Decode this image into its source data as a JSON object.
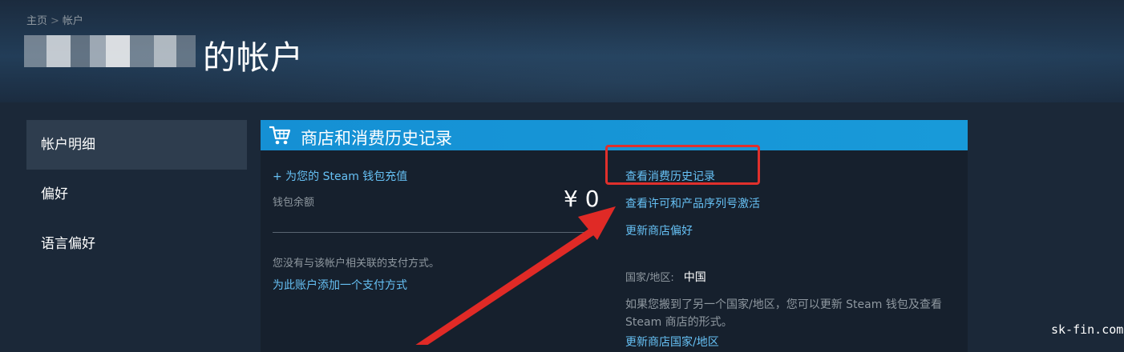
{
  "breadcrumb": {
    "home": "主页",
    "separator": ">",
    "current": "帐户"
  },
  "page_title": "的帐户",
  "sidebar": {
    "items": [
      {
        "label": "帐户明细",
        "active": true
      },
      {
        "label": "偏好",
        "active": false
      },
      {
        "label": "语言偏好",
        "active": false
      }
    ]
  },
  "panel": {
    "title": "商店和消费历史记录",
    "icon": "cart-icon",
    "left": {
      "add_funds": "+ 为您的 Steam 钱包充值",
      "wallet_label": "钱包余额",
      "wallet_amount": "¥ 0",
      "no_payment_text": "您没有与该帐户相关联的支付方式。",
      "add_payment_link": "为此账户添加一个支付方式"
    },
    "right": {
      "link_history": "查看消费历史记录",
      "link_licenses": "查看许可和产品序列号激活",
      "link_store_prefs": "更新商店偏好",
      "country_label": "国家/地区:",
      "country_value": "中国",
      "country_note": "如果您搬到了另一个国家/地区，您可以更新 Steam 钱包及查看 Steam 商店的形式。",
      "link_update_country": "更新商店国家/地区"
    }
  },
  "colors": {
    "background": "#1b2838",
    "header_bar": "#1a9fff",
    "link": "#66c0f4",
    "annotation": "#e0302c"
  },
  "watermark": "sk-fin.com"
}
